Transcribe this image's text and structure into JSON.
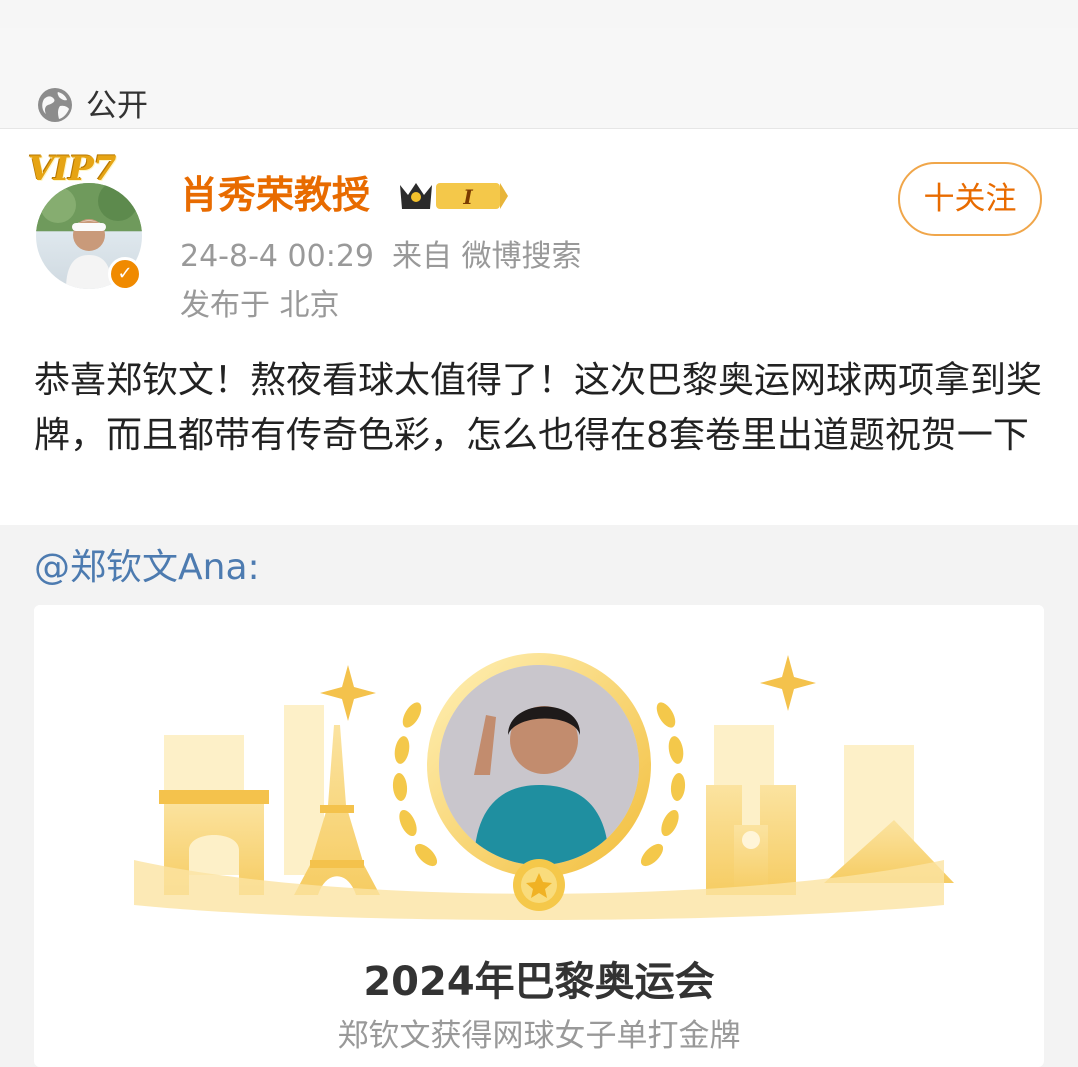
{
  "visibility": {
    "label": "公开",
    "icon": "globe-icon"
  },
  "post": {
    "author": {
      "name": "肖秀荣教授",
      "vip_label": "VIP7",
      "badge_level": "I"
    },
    "time": "24-8-4 00:29",
    "source": "来自 微博搜索",
    "location": "发布于 北京",
    "follow_label": "十关注",
    "text": "恭喜郑钦文！熬夜看球太值得了！这次巴黎奥运网球两项拿到奖牌，而且都带有传奇色彩，怎么也得在8套卷里出道题祝贺一下"
  },
  "repost": {
    "author": "@郑钦文Ana:",
    "card": {
      "title": "2024年巴黎奥运会",
      "subtitle": "郑钦文获得网球女子单打金牌"
    }
  },
  "colors": {
    "accent_orange": "#e86b00",
    "link_blue": "#4d7bb0",
    "gold": "#f5c84a"
  }
}
